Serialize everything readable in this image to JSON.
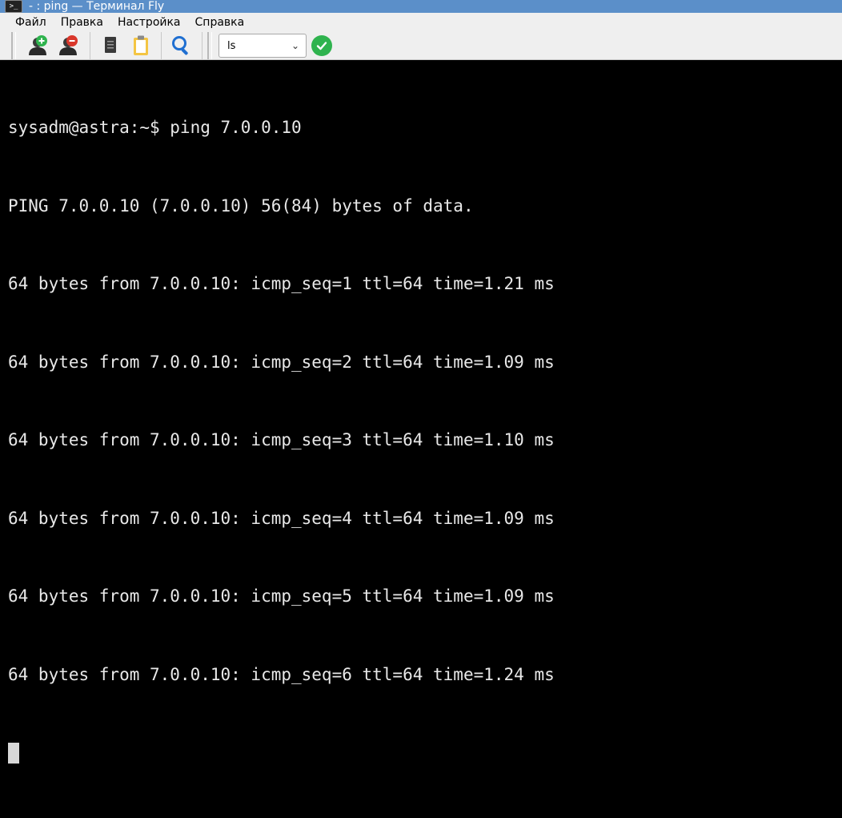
{
  "window": {
    "title": "- : ping — Терминал Fly",
    "icon": "terminal-icon"
  },
  "menu": {
    "items": [
      {
        "label": "Файл"
      },
      {
        "label": "Правка"
      },
      {
        "label": "Настройка"
      },
      {
        "label": "Справка"
      }
    ]
  },
  "toolbar": {
    "buttons": [
      {
        "name": "new-session-button",
        "icon": "user-add-icon"
      },
      {
        "name": "close-session-button",
        "icon": "user-remove-icon"
      },
      {
        "name": "copy-button",
        "icon": "copy-icon"
      },
      {
        "name": "paste-button",
        "icon": "clipboard-icon"
      },
      {
        "name": "find-button",
        "icon": "search-icon"
      }
    ],
    "command_value": "ls",
    "run_icon": "checkmark-icon",
    "colors": {
      "run": "#2fb34e",
      "add": "#2fb34e",
      "remove": "#d9372b"
    }
  },
  "terminal": {
    "lines": [
      "sysadm@astra:~$ ping 7.0.0.10",
      "PING 7.0.0.10 (7.0.0.10) 56(84) bytes of data.",
      "64 bytes from 7.0.0.10: icmp_seq=1 ttl=64 time=1.21 ms",
      "64 bytes from 7.0.0.10: icmp_seq=2 ttl=64 time=1.09 ms",
      "64 bytes from 7.0.0.10: icmp_seq=3 ttl=64 time=1.10 ms",
      "64 bytes from 7.0.0.10: icmp_seq=4 ttl=64 time=1.09 ms",
      "64 bytes from 7.0.0.10: icmp_seq=5 ttl=64 time=1.09 ms",
      "64 bytes from 7.0.0.10: icmp_seq=6 ttl=64 time=1.24 ms"
    ]
  }
}
